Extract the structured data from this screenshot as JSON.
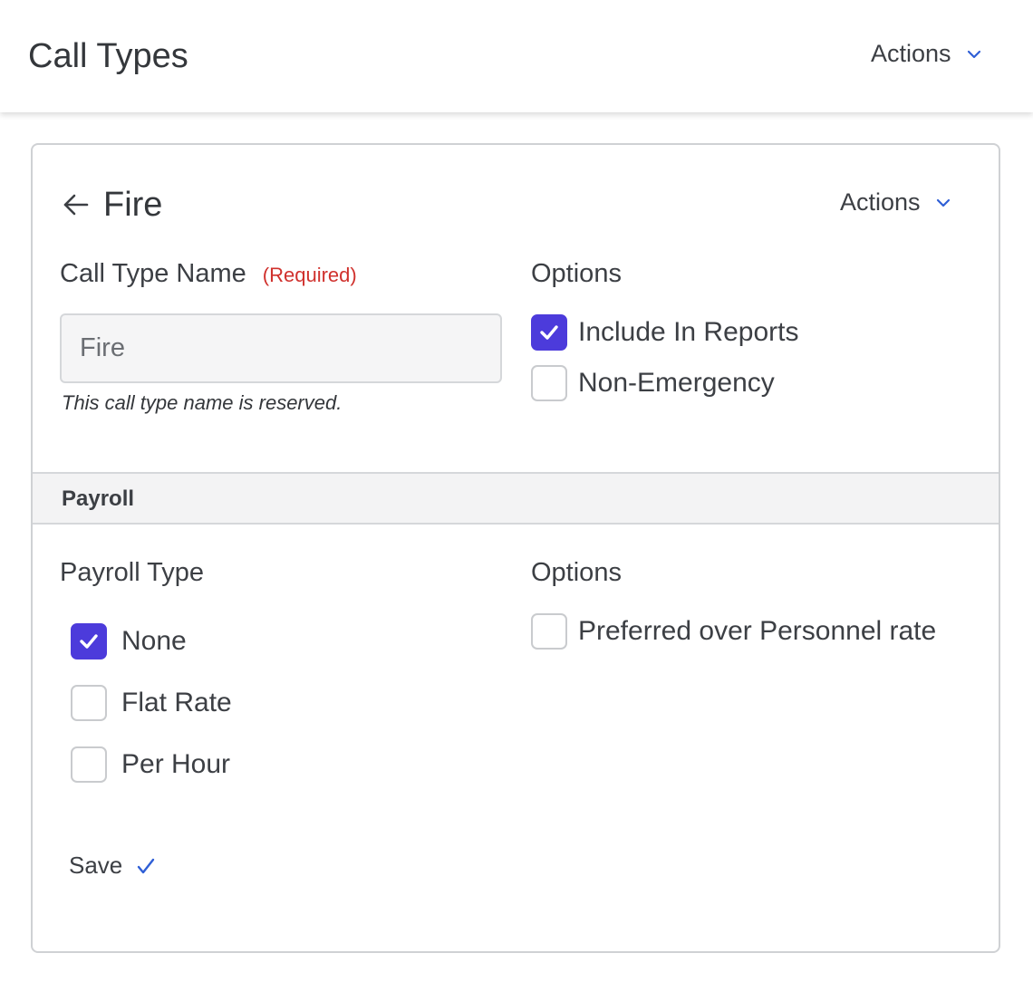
{
  "header": {
    "title": "Call Types",
    "actions_label": "Actions",
    "actions_icon": "chevron-down-icon"
  },
  "card": {
    "back_icon": "arrow-left-icon",
    "title": "Fire",
    "actions_label": "Actions",
    "name_field": {
      "label": "Call Type Name",
      "required_text": "(Required)",
      "value": "Fire",
      "placeholder": "",
      "hint": "This call type name is reserved."
    },
    "options": {
      "label": "Options",
      "items": [
        {
          "label": "Include In Reports",
          "checked": true
        },
        {
          "label": "Non-Emergency",
          "checked": false
        }
      ]
    },
    "payroll": {
      "section_title": "Payroll",
      "type_label": "Payroll Type",
      "types": [
        {
          "label": "None",
          "checked": true
        },
        {
          "label": "Flat Rate",
          "checked": false
        },
        {
          "label": "Per Hour",
          "checked": false
        }
      ],
      "options_label": "Options",
      "options": [
        {
          "label": "Preferred over Personnel rate",
          "checked": false
        }
      ]
    },
    "save_label": "Save",
    "save_icon": "checkmark-icon"
  },
  "colors": {
    "accent": "#4c3bdb",
    "link_blue": "#2f5fd6",
    "required_red": "#d0312d",
    "section_bg": "#f3f3f4"
  }
}
